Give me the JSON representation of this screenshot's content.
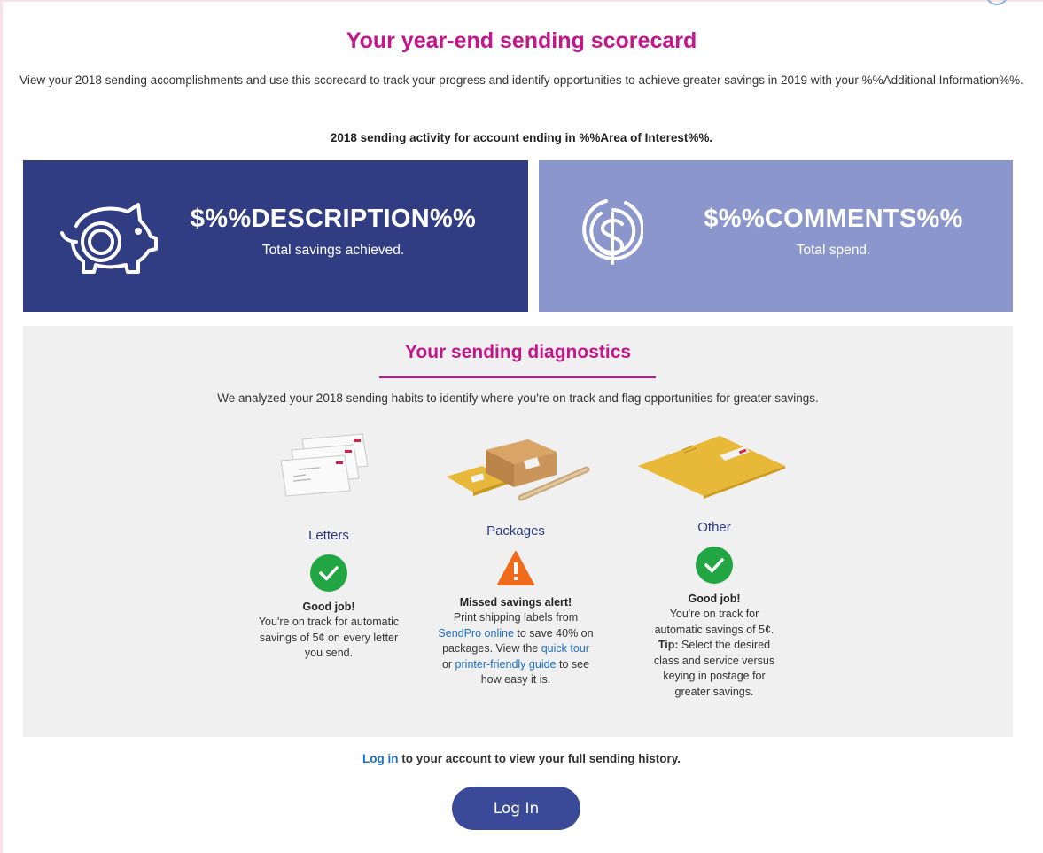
{
  "header": {
    "title": "Your year-end sending scorecard",
    "intro": "View your 2018 sending accomplishments and use this scorecard to track your progress and identify opportunities to achieve greater savings in 2019 with your %%Additional Information%%.",
    "activity": "2018 sending activity for account ending in %%Area of Interest%%."
  },
  "cards": {
    "savings": {
      "value": "$%%DESCRIPTION%%",
      "caption": "Total savings achieved.",
      "icon": "piggy-bank-icon",
      "color": "#313d83"
    },
    "spend": {
      "value": "$%%COMMENTS%%",
      "caption": "Total spend.",
      "icon": "dollar-coin-icon",
      "color": "#8b97cc"
    }
  },
  "diagnostics": {
    "title": "Your sending diagnostics",
    "intro": "We analyzed your 2018 sending habits to identify where you're on track and flag opportunities for greater savings.",
    "letters": {
      "label": "Letters",
      "status": "check-icon",
      "title": "Good job!",
      "text": "You're on track for automatic savings of 5¢ on every letter you send."
    },
    "packages": {
      "label": "Packages",
      "status": "warning-icon",
      "title": "Missed savings alert!",
      "text_1": "Print shipping labels from",
      "link_1": "SendPro online",
      "text_2": "to save 40% on packages. View the",
      "link_2": "quick tour",
      "text_3": "or",
      "link_3": "printer-friendly guide",
      "text_4": "to see how easy it is."
    },
    "other": {
      "label": "Other",
      "status": "check-icon",
      "title": "Good job!",
      "text": "You're on track for automatic savings of 5¢.",
      "tip_label": "Tip:",
      "tip_text": "Select the desired class and service versus keying in postage for greater savings."
    }
  },
  "footer": {
    "login_link": "Log in",
    "login_text": "to your account to view your full sending history.",
    "login_button": "Log In"
  },
  "colors": {
    "accent": "#c2168a",
    "navy": "#313d83",
    "periwinkle": "#8b97cc",
    "success": "#22a644",
    "warning": "#f06a1b",
    "link": "#1f6fc6"
  }
}
